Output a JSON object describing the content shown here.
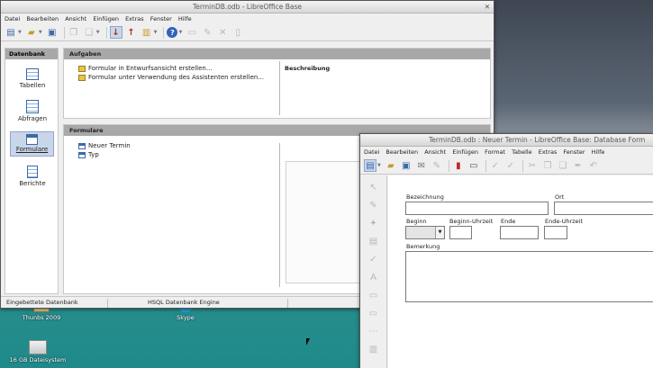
{
  "desktop": {
    "icons": [
      {
        "label": "Thunbs 2009"
      },
      {
        "label": "Skype"
      },
      {
        "label": "16 GB Dateisystem"
      }
    ]
  },
  "base_window": {
    "title": "TerminDB.odb - LibreOffice Base",
    "menu": [
      "Datei",
      "Bearbeiten",
      "Ansicht",
      "Einfügen",
      "Extras",
      "Fenster",
      "Hilfe"
    ],
    "sidebar": {
      "header": "Datenbank",
      "items": [
        {
          "label": "Tabellen",
          "icon": "table-icon"
        },
        {
          "label": "Abfragen",
          "icon": "query-icon"
        },
        {
          "label": "Formulare",
          "icon": "form-icon"
        },
        {
          "label": "Berichte",
          "icon": "report-icon"
        }
      ]
    },
    "tasks": {
      "header": "Aufgaben",
      "items": [
        "Formular in Entwurfsansicht erstellen...",
        "Formular unter Verwendung des Assistenten erstellen..."
      ],
      "description_label": "Beschreibung"
    },
    "forms": {
      "header": "Formulare",
      "items": [
        "Neuer Termin",
        "Typ"
      ]
    },
    "status": [
      "Eingebettete Datenbank",
      "HSQL Datenbank Engine"
    ]
  },
  "form_window": {
    "title": "TerminDB.odb : Neuer Termin - LibreOffice Base: Database Form",
    "menu": [
      "Datei",
      "Bearbeiten",
      "Ansicht",
      "Einfügen",
      "Format",
      "Tabelle",
      "Extras",
      "Fenster",
      "Hilfe"
    ],
    "fields": {
      "bezeichnung": "Bezeichnung",
      "ort": "Ort",
      "beginn": "Beginn",
      "beginn_uhrzeit": "Beginn-Uhrzeit",
      "ende": "Ende",
      "ende_uhrzeit": "Ende-Uhrzeit",
      "bemerkung": "Bemerkung"
    }
  }
}
